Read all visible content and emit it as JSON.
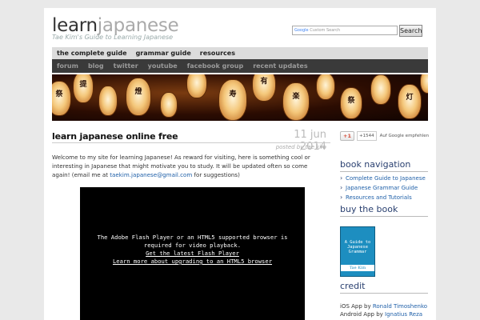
{
  "site": {
    "logo_part1": "learn",
    "logo_part2": "japanese",
    "tagline": "Tae Kim's Guide to Learning Japanese"
  },
  "search": {
    "placeholder_brand": "Google",
    "placeholder_text": "Custom Search",
    "button_label": "Search"
  },
  "nav_primary": [
    "the complete guide",
    "grammar guide",
    "resources"
  ],
  "nav_secondary": [
    "forum",
    "blog",
    "twitter",
    "youtube",
    "facebook group",
    "recent updates"
  ],
  "banner": {
    "lantern_text": [
      "祭",
      "提",
      "燈",
      "寿",
      "有",
      "楽",
      "祭",
      "灯"
    ]
  },
  "post": {
    "title": "learn japanese online free",
    "date": "11 jun 2014",
    "posted_by": "posted by tae kim",
    "body_before": "Welcome to my site for learning Japanese! As reward for visiting, here is something cool or interesting in Japanese that might motivate you to study. It will be updated often so come again! (email me at ",
    "email": "taekim.japanese@gmail.com",
    "body_after": " for suggestions)"
  },
  "flash": {
    "message": "The Adobe Flash Player or an HTML5 supported browser is required for video playback.",
    "link1": "Get the latest Flash Player",
    "link2": "Learn more about upgrading to an HTML5 browser"
  },
  "gplus": {
    "button": "+1",
    "count": "+1544",
    "recommend": "Auf Google empfehlen"
  },
  "sidebar": {
    "book_nav_title": "book navigation",
    "book_nav_items": [
      "Complete Guide to Japanese",
      "Japanese Grammar Guide",
      "Resources and Tutorials"
    ],
    "buy_book_title": "buy the book",
    "book_cover_title": "A Guide to Japanese Grammar",
    "book_cover_author": "Tae Kim",
    "credit_title": "credit",
    "credit_ios_label": "iOS App by ",
    "credit_ios_name": "Ronald Timoshenko",
    "credit_android_label": "Android App by ",
    "credit_android_name": "Ignatius Reza Lesmana"
  },
  "colors": {
    "link": "#1e5fa8",
    "nav_dark": "#3a3a3a",
    "nav_light": "#dcdcdc",
    "sidebar_heading": "#2a4070",
    "book_blue": "#1d8ec0"
  }
}
